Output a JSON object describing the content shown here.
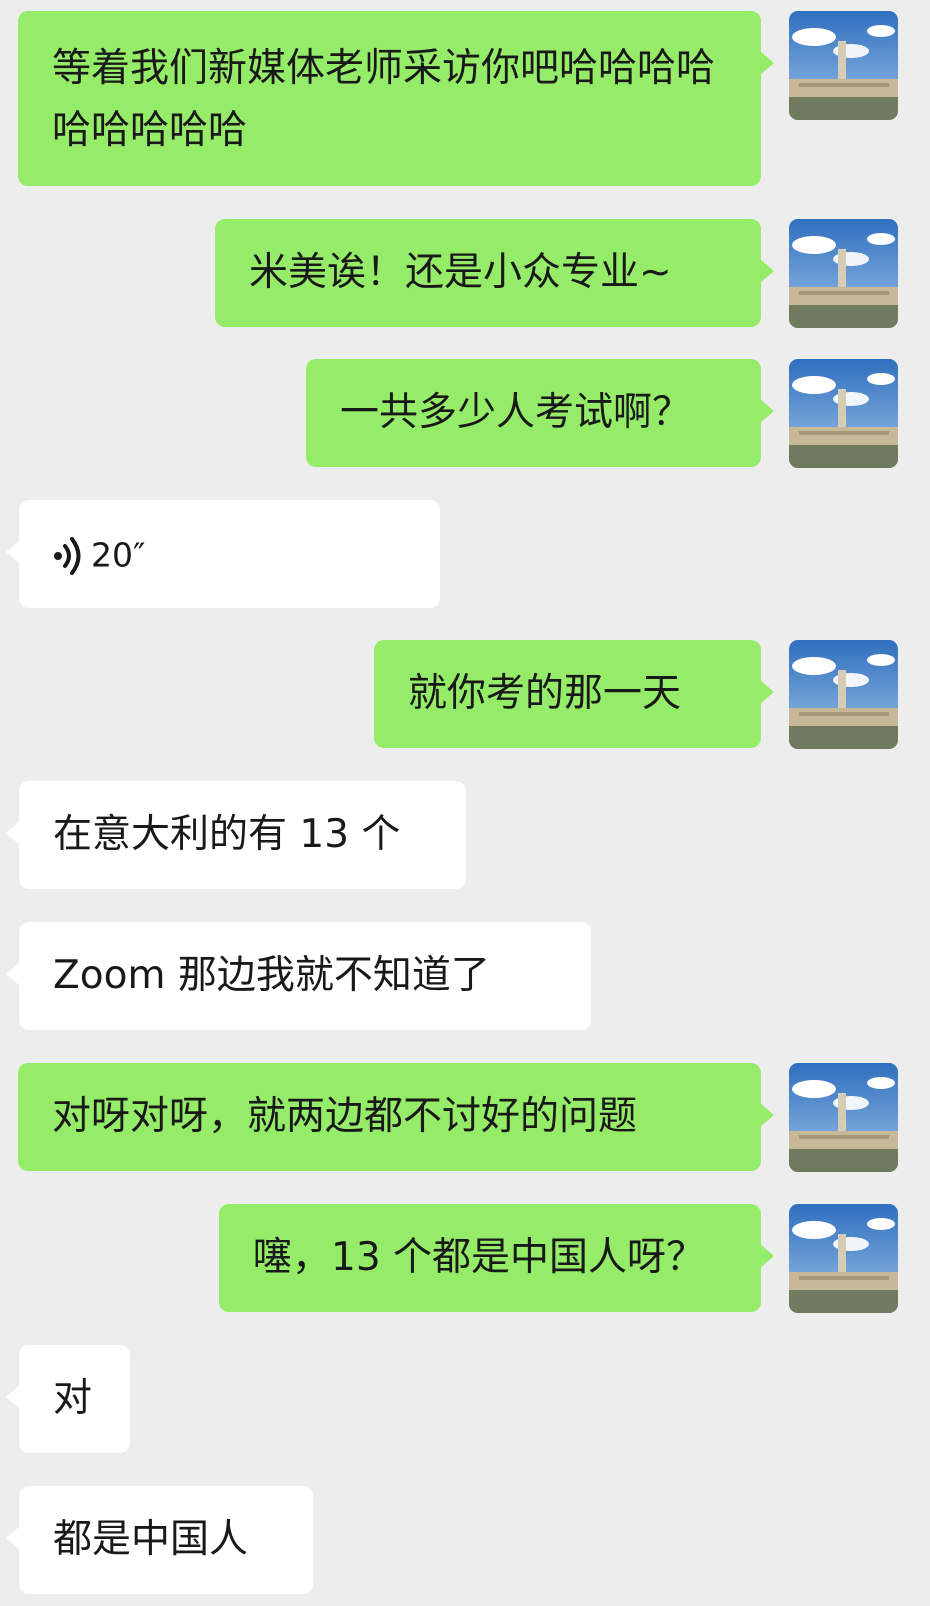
{
  "messages": [
    {
      "side": "self",
      "text": "等着我们新媒体老师采访你吧哈哈哈哈哈哈哈哈哈"
    },
    {
      "side": "self",
      "text": "米美诶！还是小众专业~"
    },
    {
      "side": "self",
      "text": "一共多少人考试啊？"
    },
    {
      "side": "other",
      "type": "voice",
      "duration": "20″"
    },
    {
      "side": "self",
      "text": "就你考的那一天"
    },
    {
      "side": "other",
      "text": "在意大利的有 13 个"
    },
    {
      "side": "other",
      "text": "Zoom 那边我就不知道了"
    },
    {
      "side": "self",
      "text": "对呀对呀，就两边都不讨好的问题"
    },
    {
      "side": "self",
      "text": "噻，13 个都是中国人呀？"
    },
    {
      "side": "other",
      "text": "对"
    },
    {
      "side": "other",
      "text": "都是中国人"
    }
  ],
  "colors": {
    "self_bubble": "#95ec69",
    "other_bubble": "#ffffff",
    "background": "#ededed"
  },
  "icons": {
    "avatar": "avatar-plaza-photo",
    "voice": "voice-wave-icon"
  }
}
